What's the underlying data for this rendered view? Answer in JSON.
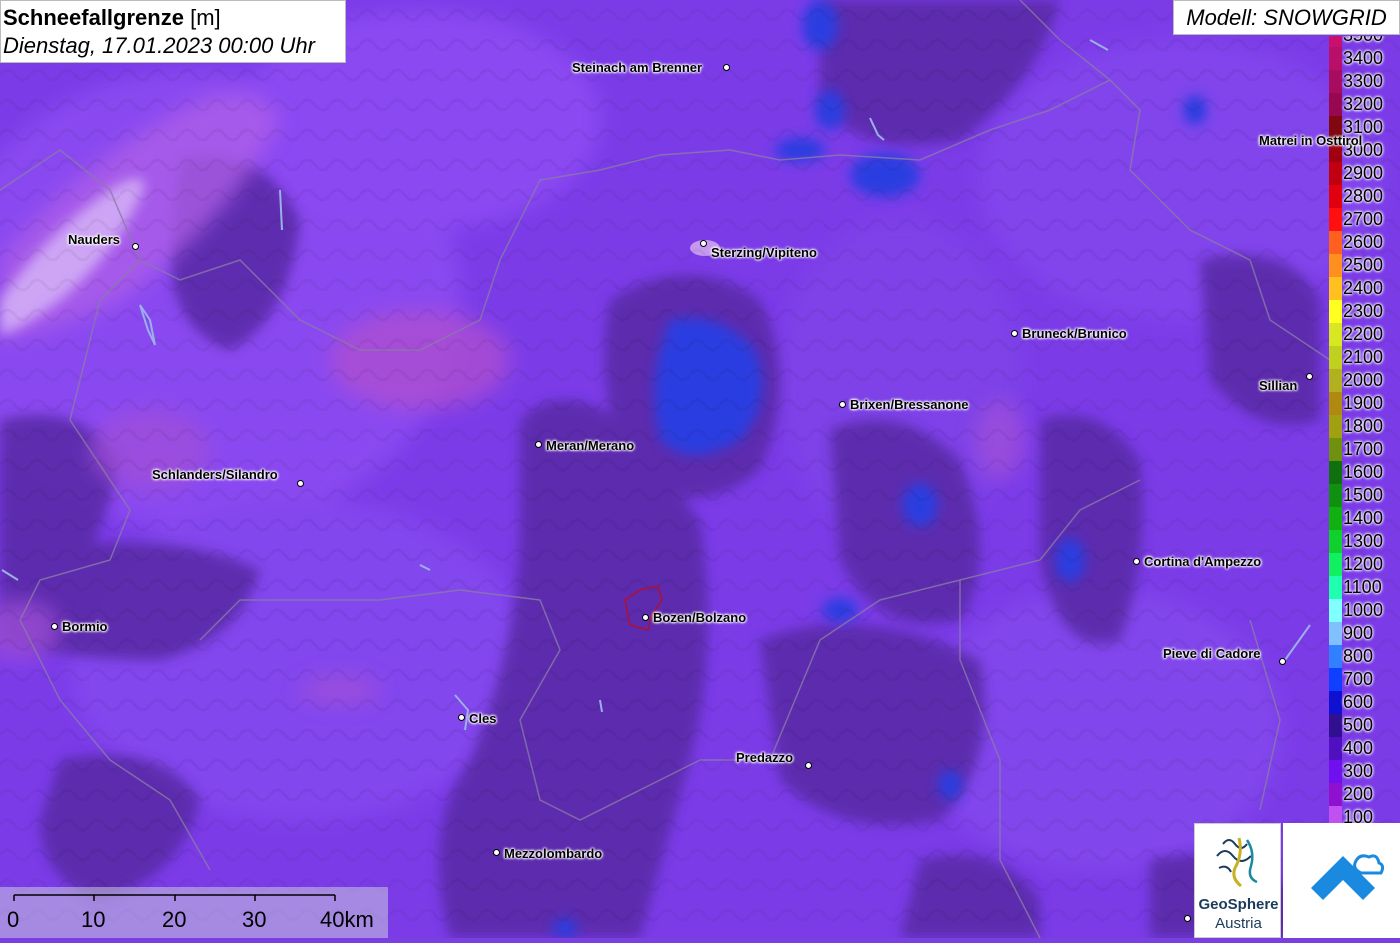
{
  "title": {
    "main": "Schneefallgrenze",
    "unit": "[m]",
    "date": "Dienstag, 17.01.2023 00:00 Uhr"
  },
  "model": "Modell: SNOWGRID",
  "legend": [
    {
      "label": "3500",
      "color": "#c8106e"
    },
    {
      "label": "3400",
      "color": "#b8106a"
    },
    {
      "label": "3300",
      "color": "#a80c60"
    },
    {
      "label": "3200",
      "color": "#980850"
    },
    {
      "label": "3100",
      "color": "#800810"
    },
    {
      "label": "3000",
      "color": "#a00010"
    },
    {
      "label": "2900",
      "color": "#c00010"
    },
    {
      "label": "2800",
      "color": "#e00010"
    },
    {
      "label": "2700",
      "color": "#ff1010"
    },
    {
      "label": "2600",
      "color": "#ff6020"
    },
    {
      "label": "2500",
      "color": "#ff9020"
    },
    {
      "label": "2400",
      "color": "#ffc020"
    },
    {
      "label": "2300",
      "color": "#ffff20"
    },
    {
      "label": "2200",
      "color": "#d8e820"
    },
    {
      "label": "2100",
      "color": "#c0d020"
    },
    {
      "label": "2000",
      "color": "#b0b020"
    },
    {
      "label": "1900",
      "color": "#b08a10"
    },
    {
      "label": "1800",
      "color": "#a0a010"
    },
    {
      "label": "1700",
      "color": "#709010"
    },
    {
      "label": "1600",
      "color": "#107010"
    },
    {
      "label": "1500",
      "color": "#109010"
    },
    {
      "label": "1400",
      "color": "#10b010"
    },
    {
      "label": "1300",
      "color": "#10d030"
    },
    {
      "label": "1200",
      "color": "#10f060"
    },
    {
      "label": "1100",
      "color": "#20ffb0"
    },
    {
      "label": "1000",
      "color": "#80ffff"
    },
    {
      "label": "900",
      "color": "#80c0ff"
    },
    {
      "label": "800",
      "color": "#3080ff"
    },
    {
      "label": "700",
      "color": "#1040ff"
    },
    {
      "label": "600",
      "color": "#1010d0"
    },
    {
      "label": "500",
      "color": "#301090"
    },
    {
      "label": "400",
      "color": "#5010c0"
    },
    {
      "label": "300",
      "color": "#7010f0"
    },
    {
      "label": "200",
      "color": "#9010d0"
    },
    {
      "label": "100",
      "color": "#c050f0"
    }
  ],
  "cities": [
    {
      "name": "Steinach am Brenner"
    },
    {
      "name": "Matrei in Osttirol"
    },
    {
      "name": "Nauders"
    },
    {
      "name": "Sterzing/Vipiteno"
    },
    {
      "name": "Bruneck/Brunico"
    },
    {
      "name": "Sillian"
    },
    {
      "name": "Brixen/Bressanone"
    },
    {
      "name": "Meran/Merano"
    },
    {
      "name": "Schlanders/Silandro"
    },
    {
      "name": "Cortina d'Ampezzo"
    },
    {
      "name": "Bozen/Bolzano"
    },
    {
      "name": "Bormio"
    },
    {
      "name": "Pieve di Cadore"
    },
    {
      "name": "Cles"
    },
    {
      "name": "Predazzo"
    },
    {
      "name": "Mezzolombardo"
    }
  ],
  "scale": {
    "labels": [
      "0",
      "10",
      "20",
      "30",
      "40km"
    ]
  },
  "logo": {
    "name": "GeoSphere",
    "sub": "Austria"
  }
}
